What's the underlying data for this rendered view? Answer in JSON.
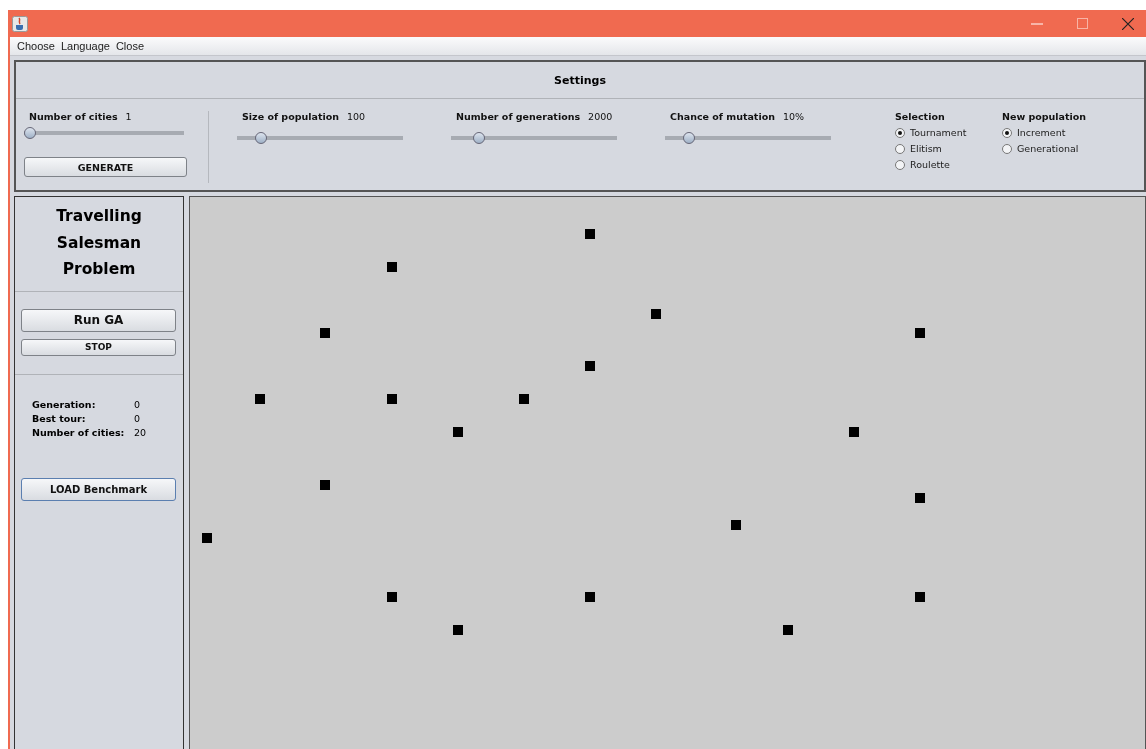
{
  "menu": [
    "Choose",
    "Language",
    "Close"
  ],
  "settings": {
    "title": "Settings",
    "sliders": [
      {
        "label": "Number of cities",
        "value": "1",
        "level": 0
      },
      {
        "label": "Size of population",
        "value": "100",
        "level": 0.12
      },
      {
        "label": "Number of generations",
        "value": "2000",
        "level": 0.14
      },
      {
        "label": "Chance of mutation",
        "value": "10%",
        "level": 0.12
      }
    ],
    "generate_button": "GENERATE",
    "selection": {
      "label": "Selection",
      "options": [
        {
          "label": "Tournament",
          "selected": true
        },
        {
          "label": "Elitism",
          "selected": false
        },
        {
          "label": "Roulette",
          "selected": false
        }
      ]
    },
    "new_population": {
      "label": "New population",
      "options": [
        {
          "label": "Increment",
          "selected": true
        },
        {
          "label": "Generational",
          "selected": false
        }
      ]
    }
  },
  "sidebar": {
    "title": "Travelling Salesman Problem",
    "run_button": "Run GA",
    "stop_button": "STOP",
    "stats": [
      {
        "label": "Generation:",
        "value": "0"
      },
      {
        "label": "Best tour:",
        "value": "0"
      },
      {
        "label": "Number of cities:",
        "value": "20"
      }
    ],
    "load_button": "LOAD Benchmark"
  }
}
